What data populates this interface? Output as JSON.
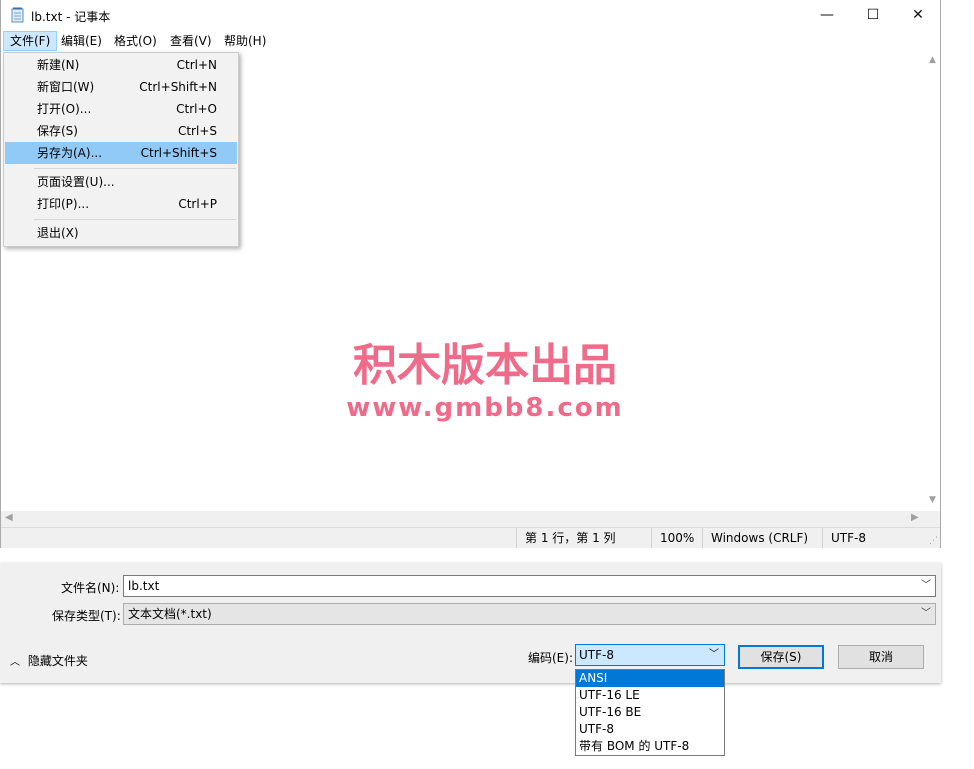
{
  "window": {
    "title": "lb.txt - 记事本",
    "minimize": "—",
    "maximize": "☐",
    "close": "✕"
  },
  "menubar": [
    "文件(F)",
    "编辑(E)",
    "格式(O)",
    "查看(V)",
    "帮助(H)"
  ],
  "file_menu": [
    {
      "label": "新建(N)",
      "shortcut": "Ctrl+N"
    },
    {
      "label": "新窗口(W)",
      "shortcut": "Ctrl+Shift+N"
    },
    {
      "label": "打开(O)...",
      "shortcut": "Ctrl+O"
    },
    {
      "label": "保存(S)",
      "shortcut": "Ctrl+S"
    },
    {
      "label": "另存为(A)...",
      "shortcut": "Ctrl+Shift+S"
    },
    {
      "label": "页面设置(U)...",
      "shortcut": ""
    },
    {
      "label": "打印(P)...",
      "shortcut": "Ctrl+P"
    },
    {
      "label": "退出(X)",
      "shortcut": ""
    }
  ],
  "watermark": {
    "line1": "积木版本出品",
    "line2": "www.gmbb8.com"
  },
  "statusbar": {
    "position": "第 1 行，第 1 列",
    "zoom": "100%",
    "line_ending": "Windows (CRLF)",
    "encoding": "UTF-8"
  },
  "save_dialog": {
    "filename_label": "文件名(N):",
    "filename_value": "lb.txt",
    "filetype_label": "保存类型(T):",
    "filetype_value": "文本文档(*.txt)",
    "hide_folders": "隐藏文件夹",
    "encoding_label": "编码(E):",
    "encoding_value": "UTF-8",
    "save_button": "保存(S)",
    "cancel_button": "取消",
    "encoding_options": [
      "ANSI",
      "UTF-16 LE",
      "UTF-16 BE",
      "UTF-8",
      "带有 BOM 的 UTF-8"
    ],
    "selected_option": "ANSI"
  },
  "colors": {
    "watermark": "#f06a8a",
    "menu_highlight": "#91c9f7",
    "accent": "#0078d7"
  }
}
